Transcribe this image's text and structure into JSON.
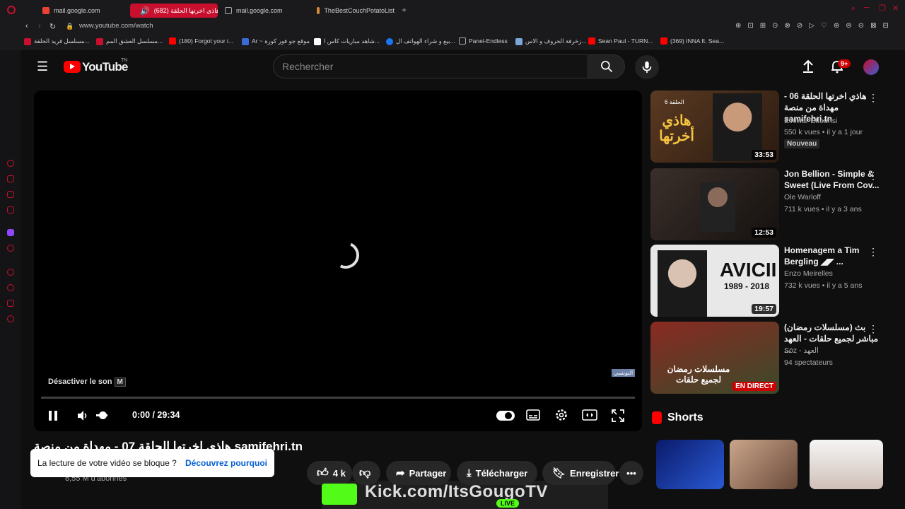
{
  "browser": {
    "tabs": [
      {
        "label": "mail.google.com",
        "active": false
      },
      {
        "label": "(682) هاذي اخرتها الحلقة",
        "active": true
      },
      {
        "label": "mail.google.com",
        "active": false
      },
      {
        "label": "TheBestCouchPotatoList",
        "active": false
      }
    ],
    "url": "www.youtube.com/watch",
    "bookmarks": [
      "مسلسل فريد الحلقة...",
      "مسلسل العشق المم...",
      "(180) Forgot your i...",
      "Ar ~ موقع جو فور كورة",
      "شاهد مباريات كاس ا...",
      "بيع و شراء الهواتف ال...",
      "Panel-Endless",
      "زخرفة الحروف و الاس...",
      "Sean Paul - TURN...",
      "(369) INNA ft. Sea..."
    ]
  },
  "header": {
    "logo_text": "YouTube",
    "country_code": "TN",
    "search_placeholder": "Rechercher",
    "notif_badge": "9+"
  },
  "player": {
    "mute_tip": "Désactiver le son",
    "mute_key": "M",
    "time": "0:00 / 29:34",
    "watermark": "التونسي"
  },
  "video": {
    "title": "هاذي اخرتها الحلقة 07 - مهداة من منصة samifehri.tn",
    "subscribers": "8,55 M d'abonnés",
    "likes": "4 k",
    "share": "Partager",
    "download": "Télécharger",
    "save": "Enregistrer"
  },
  "toast": {
    "text": "La lecture de votre vidéo se bloque ?",
    "link": "Découvrez pourquoi"
  },
  "recommendations": [
    {
      "title": "هاذي اخرتها الحلقة 06 - مهداة من منصة samifehri.tn",
      "channel": "Elhiwar Ettounsi",
      "meta": "550 k vues • il y a 1 jour",
      "badge": "Nouveau",
      "duration": "33:53",
      "thumb_text": "هاذي أخرتها",
      "thumb_label": "الحلقة 6"
    },
    {
      "title": "Jon Bellion - Simple & Sweet (Live From Cov...",
      "channel": "Ole Warloff",
      "meta": "711 k vues • il y a 3 ans",
      "badge": "",
      "duration": "12:53",
      "thumb_text": "",
      "thumb_label": ""
    },
    {
      "title": "Homenagem a Tim Bergling ◢◤ ...",
      "channel": "Enzo Meirelles",
      "meta": "732 k vues • il y a 5 ans",
      "badge": "",
      "duration": "19:57",
      "thumb_text": "AVICII",
      "thumb_label": "1989 - 2018"
    },
    {
      "title": "(مسلسلات رمضان) بث مباشر لجميع حلقات - العهد ...",
      "channel": "Söz - العهد",
      "meta": "94 spectateurs",
      "badge": "",
      "duration": "EN DIRECT",
      "thumb_text": "مسلسلات رمضان لجميع حلقات",
      "thumb_label": ""
    }
  ],
  "shorts": {
    "title": "Shorts"
  },
  "overlay": {
    "kick_text": "Kick.com/ItsGougoTV",
    "live": "LIVE"
  },
  "colors": {
    "brand_red": "#ff0000",
    "accent": "#c8102e",
    "kick_green": "#53fc18"
  }
}
